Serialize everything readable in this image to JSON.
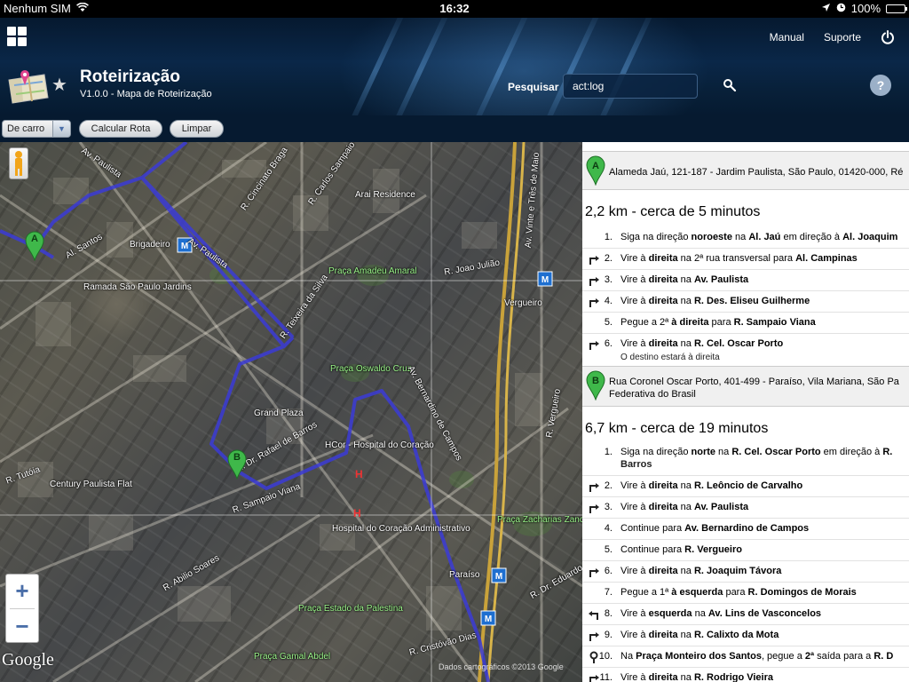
{
  "status_bar": {
    "carrier": "Nenhum SIM",
    "time": "16:32",
    "battery": "100%"
  },
  "header": {
    "nav": {
      "manual": "Manual",
      "support": "Suporte"
    },
    "app_title": "Roteirização",
    "app_subtitle": "V1.0.0 - Mapa de Roteirização",
    "search_label": "Pesquisar",
    "search_value": "act:log",
    "help": "?"
  },
  "toolbar": {
    "mode_select": "De carro",
    "calc_button": "Calcular Rota",
    "clear_button": "Limpar"
  },
  "map": {
    "labels": [
      "Av. Paulista",
      "R. Cincinato Braga",
      "Brigadeiro",
      "Al. Santos",
      "Ramada São Paulo Jardins",
      "Praça Amadeu Amaral",
      "Arai Residence",
      "R. Joao Julião",
      "Vergueiro",
      "Praça Oswaldo Cruz",
      "Grand Plaza",
      "R. Dr. Rafael de Barros",
      "HCor - Hospital do Coração",
      "Century Paulista Flat",
      "R. Sampaio Viana",
      "Hospital do Coração Administrativo",
      "Av. Bernardino de Campos",
      "Praça Zacharias Zanchetta Molina",
      "Paraíso",
      "Praça Estado da Palestina",
      "Praça Gamal Abdel",
      "R. Tutóia",
      "R. Abilio Soares",
      "R. Cristóvão Dias",
      "R. Vergueiro",
      "R. Dr. Eduardo",
      "Av. Vinte e Três de Maio",
      "R. Carlos Sampaio",
      "R. Teixeira da Silva"
    ],
    "marker_a": "A",
    "marker_b": "B",
    "zoom_in": "+",
    "zoom_out": "−",
    "google": "Google",
    "attribution": "Dados cartográficos ©2013 Google"
  },
  "directions": {
    "waypoint_a": {
      "letter": "A",
      "address": "Alameda Jaú, 121-187 - Jardim Paulista, São Paulo, 01420-000, Ré"
    },
    "leg1": {
      "summary": "2,2 km - cerca de 5 minutos",
      "steps": [
        {
          "num": "1.",
          "icon": "none",
          "parts": [
            "Siga na direção ",
            "noroeste",
            " na ",
            "Al. Jaú",
            " em direção à ",
            "Al. Joaquim"
          ]
        },
        {
          "num": "2.",
          "icon": "turn-right",
          "parts": [
            "Vire à ",
            "direita",
            " na 2ª rua transversal para ",
            "Al. Campinas",
            "",
            ""
          ]
        },
        {
          "num": "3.",
          "icon": "turn-right",
          "parts": [
            "Vire à ",
            "direita",
            " na ",
            "Av. Paulista",
            "",
            ""
          ]
        },
        {
          "num": "4.",
          "icon": "turn-right",
          "parts": [
            "Vire à ",
            "direita",
            " na ",
            "R. Des. Eliseu Guilherme",
            "",
            ""
          ]
        },
        {
          "num": "5.",
          "icon": "none",
          "parts": [
            "Pegue a 2ª ",
            "à direita",
            " para ",
            "R. Sampaio Viana",
            "",
            ""
          ]
        },
        {
          "num": "6.",
          "icon": "turn-right",
          "parts": [
            "Vire à ",
            "direita",
            " na ",
            "R. Cel. Oscar Porto",
            "",
            ""
          ],
          "sub": "O destino estará à direita"
        }
      ]
    },
    "waypoint_b": {
      "letter": "B",
      "address_line1": "Rua Coronel Oscar Porto, 401-499 - Paraíso, Vila Mariana, São Pa",
      "address_line2": "Federativa do Brasil"
    },
    "leg2": {
      "summary": "6,7 km - cerca de 19 minutos",
      "steps": [
        {
          "num": "1.",
          "icon": "none",
          "parts": [
            "Siga na direção ",
            "norte",
            " na ",
            "R. Cel. Oscar Porto",
            " em direção à ",
            "R."
          ],
          "line2": "Barros"
        },
        {
          "num": "2.",
          "icon": "turn-right",
          "parts": [
            "Vire à ",
            "direita",
            " na ",
            "R. Leôncio de Carvalho",
            "",
            ""
          ]
        },
        {
          "num": "3.",
          "icon": "turn-right",
          "parts": [
            "Vire à ",
            "direita",
            " na ",
            "Av. Paulista",
            "",
            ""
          ]
        },
        {
          "num": "4.",
          "icon": "none",
          "parts": [
            "Continue para ",
            "Av. Bernardino de Campos",
            "",
            "",
            "",
            ""
          ]
        },
        {
          "num": "5.",
          "icon": "none",
          "parts": [
            "Continue para ",
            "R. Vergueiro",
            "",
            "",
            "",
            ""
          ]
        },
        {
          "num": "6.",
          "icon": "turn-right",
          "parts": [
            "Vire à ",
            "direita",
            " na ",
            "R. Joaquim Távora",
            "",
            ""
          ]
        },
        {
          "num": "7.",
          "icon": "none",
          "parts": [
            "Pegue a 1ª ",
            "à esquerda",
            " para ",
            "R. Domingos de Morais",
            "",
            ""
          ]
        },
        {
          "num": "8.",
          "icon": "turn-left",
          "parts": [
            "Vire à ",
            "esquerda",
            " na ",
            "Av. Lins de Vasconcelos",
            "",
            ""
          ]
        },
        {
          "num": "9.",
          "icon": "turn-right",
          "parts": [
            "Vire à ",
            "direita",
            " na ",
            "R. Calixto da Mota",
            "",
            ""
          ]
        },
        {
          "num": "10.",
          "icon": "roundabout",
          "parts": [
            "Na ",
            "Praça Monteiro dos Santos",
            ", pegue a ",
            "2ª",
            " saída para a ",
            "R. D"
          ]
        },
        {
          "num": "11.",
          "icon": "turn-right",
          "parts": [
            "Vire à ",
            "direita",
            " na ",
            "R. Rodrigo Vieira",
            "",
            ""
          ]
        }
      ]
    }
  },
  "colors": {
    "route": "#3b3bd6",
    "header_bg": "#0a2748",
    "marker_green": "#3fb84a"
  }
}
